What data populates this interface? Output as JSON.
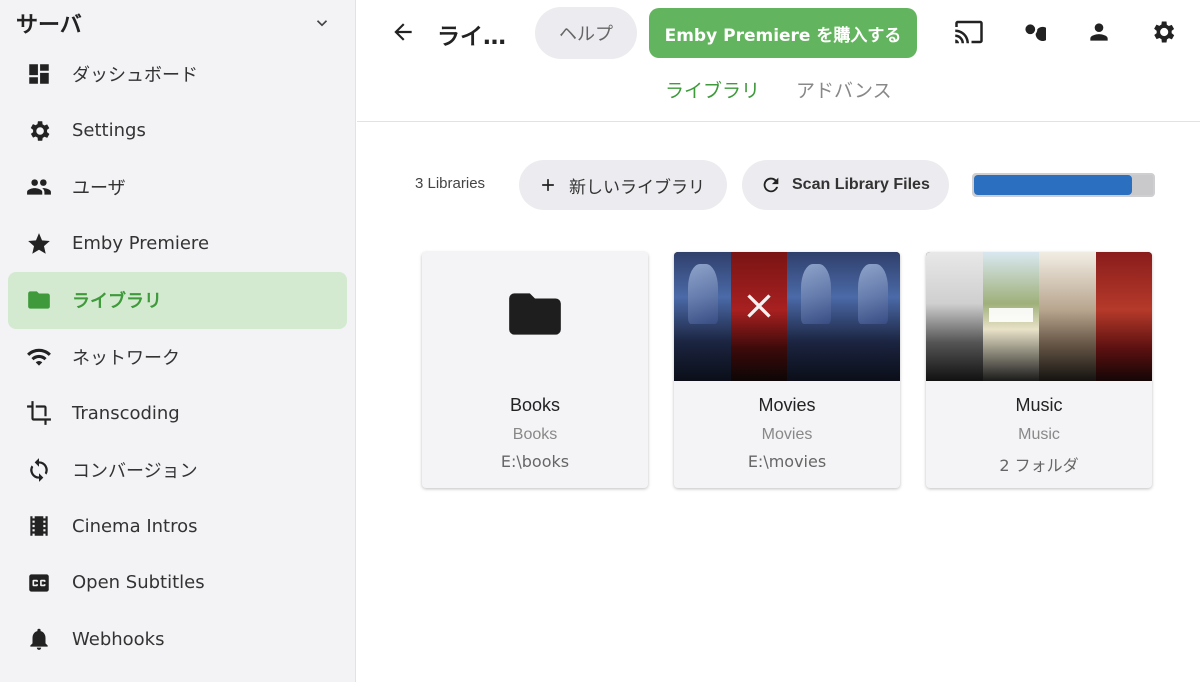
{
  "sidebar": {
    "title": "サーバ",
    "items": [
      {
        "label": "ダッシュボード",
        "icon": "dashboard-icon"
      },
      {
        "label": "Settings",
        "icon": "gear-icon"
      },
      {
        "label": "ユーザ",
        "icon": "users-icon"
      },
      {
        "label": "Emby Premiere",
        "icon": "star-icon"
      },
      {
        "label": "ライブラリ",
        "icon": "folder-icon",
        "active": true
      },
      {
        "label": "ネットワーク",
        "icon": "wifi-icon"
      },
      {
        "label": "Transcoding",
        "icon": "crop-icon"
      },
      {
        "label": "コンバージョン",
        "icon": "sync-icon"
      },
      {
        "label": "Cinema Intros",
        "icon": "film-icon"
      },
      {
        "label": "Open Subtitles",
        "icon": "closed-caption-icon"
      },
      {
        "label": "Webhooks",
        "icon": "bell-icon"
      }
    ]
  },
  "header": {
    "title": "ライ…",
    "help_label": "ヘルプ",
    "premiere_label": "Emby Premiere を購入する",
    "tabs": [
      {
        "label": "ライブラリ",
        "active": true
      },
      {
        "label": "アドバンス",
        "active": false
      }
    ]
  },
  "toolbar": {
    "count": "3 Libraries",
    "new_library_label": "新しいライブラリ",
    "scan_label": "Scan Library Files",
    "scan_progress": 0.88
  },
  "libraries": [
    {
      "name": "Books",
      "type": "Books",
      "path": "E:\\books"
    },
    {
      "name": "Movies",
      "type": "Movies",
      "path": "E:\\movies"
    },
    {
      "name": "Music",
      "type": "Music",
      "path": "2 フォルダ"
    }
  ],
  "colors": {
    "accent": "#62b55e",
    "accent_text": "#3f9a3c",
    "active_bg": "#d3ead0",
    "progress": "#2a6fc0"
  }
}
